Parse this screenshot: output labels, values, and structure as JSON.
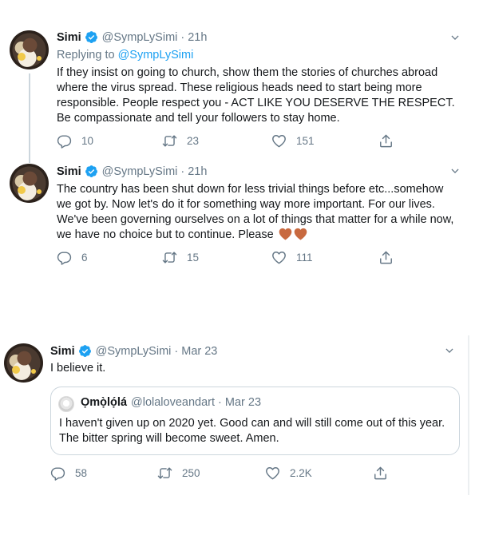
{
  "tweets": [
    {
      "name": "Simi",
      "handle": "@SympLySimi",
      "dot": "·",
      "time": "21h",
      "replying_prefix": "Replying to",
      "replying_to": "@SympLySimi",
      "text": "If they insist on going to church, show them the stories of churches abroad where the virus spread. These religious heads need to start being more responsible. People respect you - ACT LIKE YOU DESERVE THE RESPECT. Be compassionate and tell your followers to stay home.",
      "replies": "10",
      "retweets": "23",
      "likes": "151"
    },
    {
      "name": "Simi",
      "handle": "@SympLySimi",
      "dot": "·",
      "time": "21h",
      "text": "The country has been shut down for less trivial things before etc...somehow we got by. Now let's do it for something way more important. For our lives. We've been governing ourselves on a lot of things that matter for a while now, we have no choice but to continue. Please",
      "emojis": [
        "brown-heart",
        "brown-heart"
      ],
      "replies": "6",
      "retweets": "15",
      "likes": "111"
    },
    {
      "name": "Simi",
      "handle": "@SympLySimi",
      "dot": "·",
      "time": "Mar 23",
      "text": "I believe it.",
      "quote": {
        "name": "Ọmọ̀lọ́lá",
        "handle": "@lolaloveandart",
        "dot": "·",
        "time": "Mar 23",
        "text": "I haven't given up on 2020 yet. Good can and will still come out of this year. The bitter spring will become sweet. Amen."
      },
      "replies": "58",
      "retweets": "250",
      "likes": "2.2K"
    }
  ],
  "colors": {
    "accent": "#1da1f2",
    "secondary_text": "#657786",
    "primary_text": "#14171a",
    "thread_line": "#ccd6dd",
    "emoji_heart": "#c8693f"
  },
  "icons": [
    "verified-badge-icon",
    "chevron-down-icon",
    "reply-icon",
    "retweet-icon",
    "like-icon",
    "share-icon"
  ]
}
